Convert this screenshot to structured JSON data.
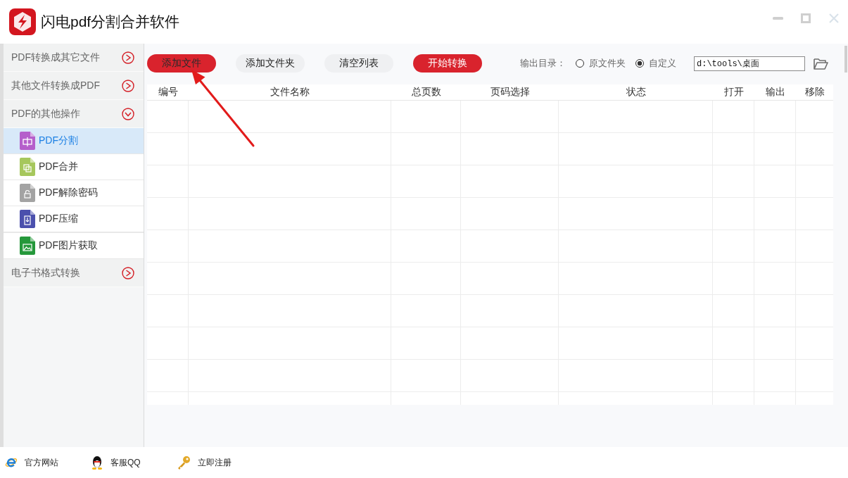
{
  "window": {
    "title": "闪电pdf分割合并软件"
  },
  "sidebar": {
    "sections": [
      {
        "label": "PDF转换成其它文件",
        "expanded": false
      },
      {
        "label": "其他文件转换成PDF",
        "expanded": false
      },
      {
        "label": "PDF的其他操作",
        "expanded": true,
        "children": [
          {
            "label": "PDF分割",
            "kind": "split",
            "color": "#b55fcb",
            "selected": true
          },
          {
            "label": "PDF合并",
            "kind": "merge",
            "color": "#a6c75c",
            "selected": false
          },
          {
            "label": "PDF解除密码",
            "kind": "unlock",
            "color": "#a3a3a3",
            "selected": false
          },
          {
            "label": "PDF压缩",
            "kind": "compress",
            "color": "#4b50ad",
            "selected": false
          },
          {
            "label": "PDF图片获取",
            "kind": "image",
            "color": "#25983b",
            "selected": false
          }
        ]
      },
      {
        "label": "电子书格式转换",
        "expanded": false
      }
    ]
  },
  "toolbar": {
    "buttons": [
      {
        "label": "添加文件",
        "kind": "highlighted"
      },
      {
        "label": "添加文件夹",
        "kind": "normal"
      },
      {
        "label": "清空列表",
        "kind": "normal"
      },
      {
        "label": "开始转换",
        "kind": "primary"
      }
    ],
    "output": {
      "label": "输出目录：",
      "options": [
        {
          "label": "原文件夹",
          "selected": false
        },
        {
          "label": "自定义",
          "selected": true
        }
      ],
      "path": "d:\\tools\\桌面"
    }
  },
  "table": {
    "columns": [
      "编号",
      "文件名称",
      "总页数",
      "页码选择",
      "状态",
      "打开",
      "输出",
      "移除"
    ]
  },
  "footer": {
    "links": [
      {
        "label": "官方网站",
        "kind": "web"
      },
      {
        "label": "客服QQ",
        "kind": "qq"
      },
      {
        "label": "立即注册",
        "kind": "key"
      }
    ]
  }
}
